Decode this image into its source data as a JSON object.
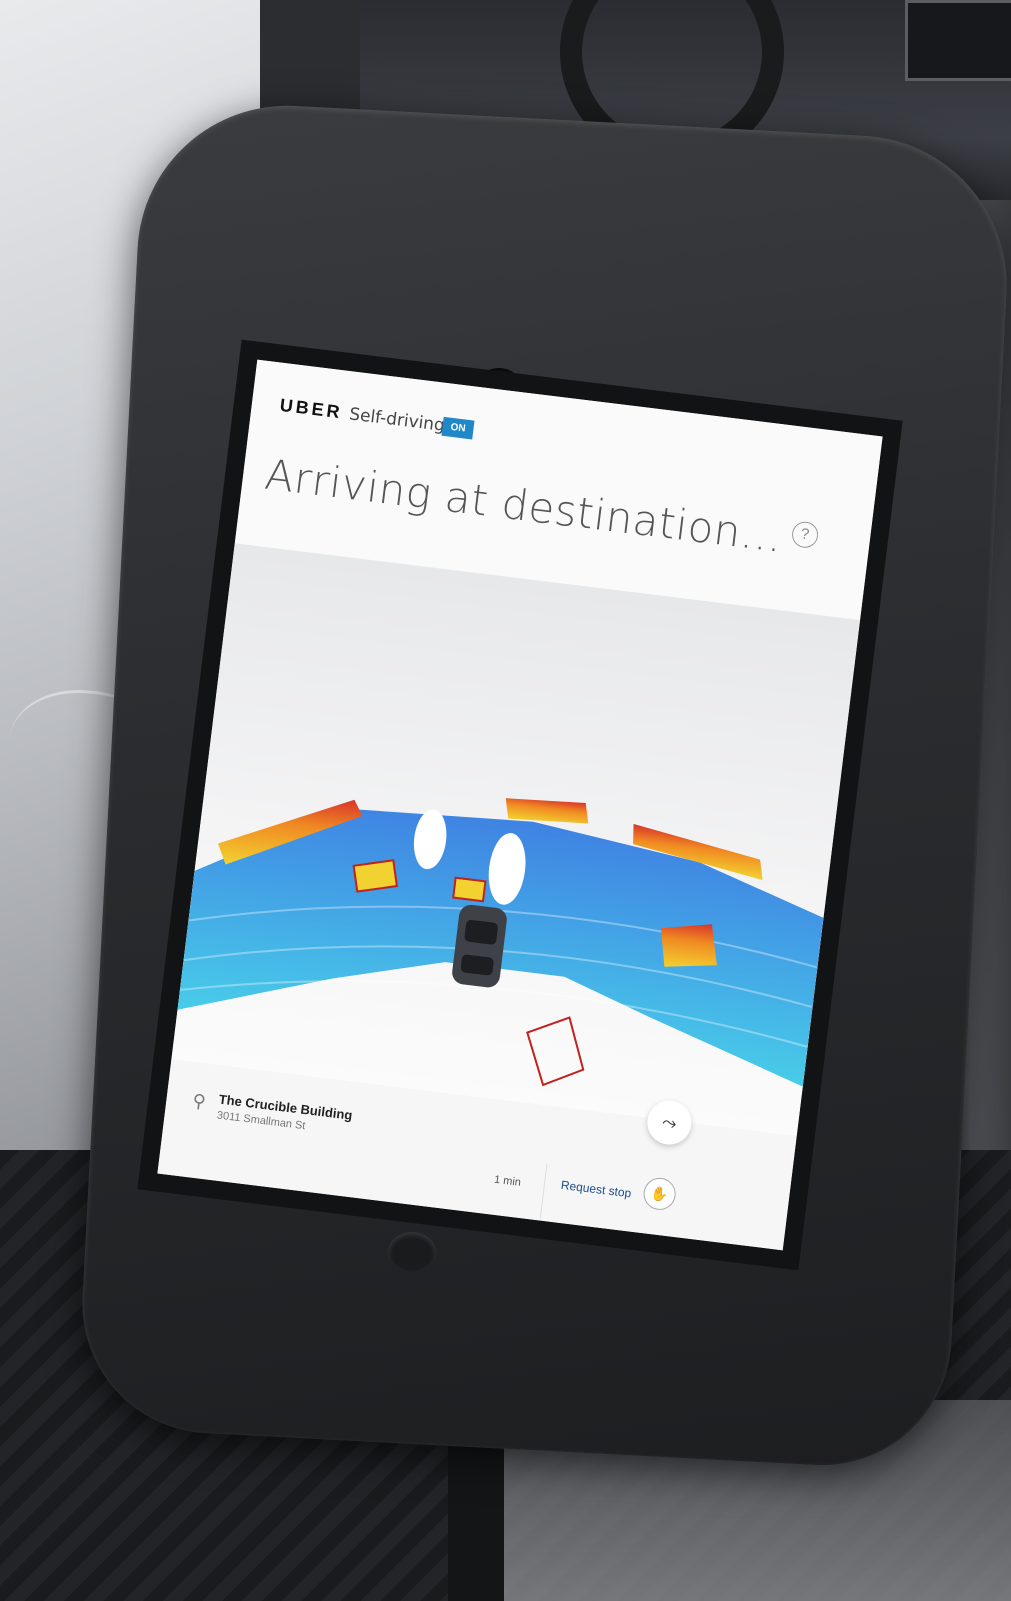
{
  "brand": {
    "logo": "UBER",
    "mode": "Self-driving",
    "status_badge": "ON"
  },
  "status": {
    "title": "Arriving at destination..."
  },
  "help": {
    "icon": "help-icon",
    "glyph": "?"
  },
  "destination": {
    "name": "The Crucible Building",
    "address": "3011 Smallman St"
  },
  "trip": {
    "eta": "1 min"
  },
  "actions": {
    "request_stop_label": "Request stop",
    "stop_icon": "hand-icon",
    "route_icon": "route-icon"
  },
  "colors": {
    "badge": "#1e88c8",
    "lidar_blue": "#1f6fe0",
    "lidar_cyan": "#29c4e6",
    "lidar_yellow": "#f2d230",
    "lidar_red": "#d8352a"
  }
}
